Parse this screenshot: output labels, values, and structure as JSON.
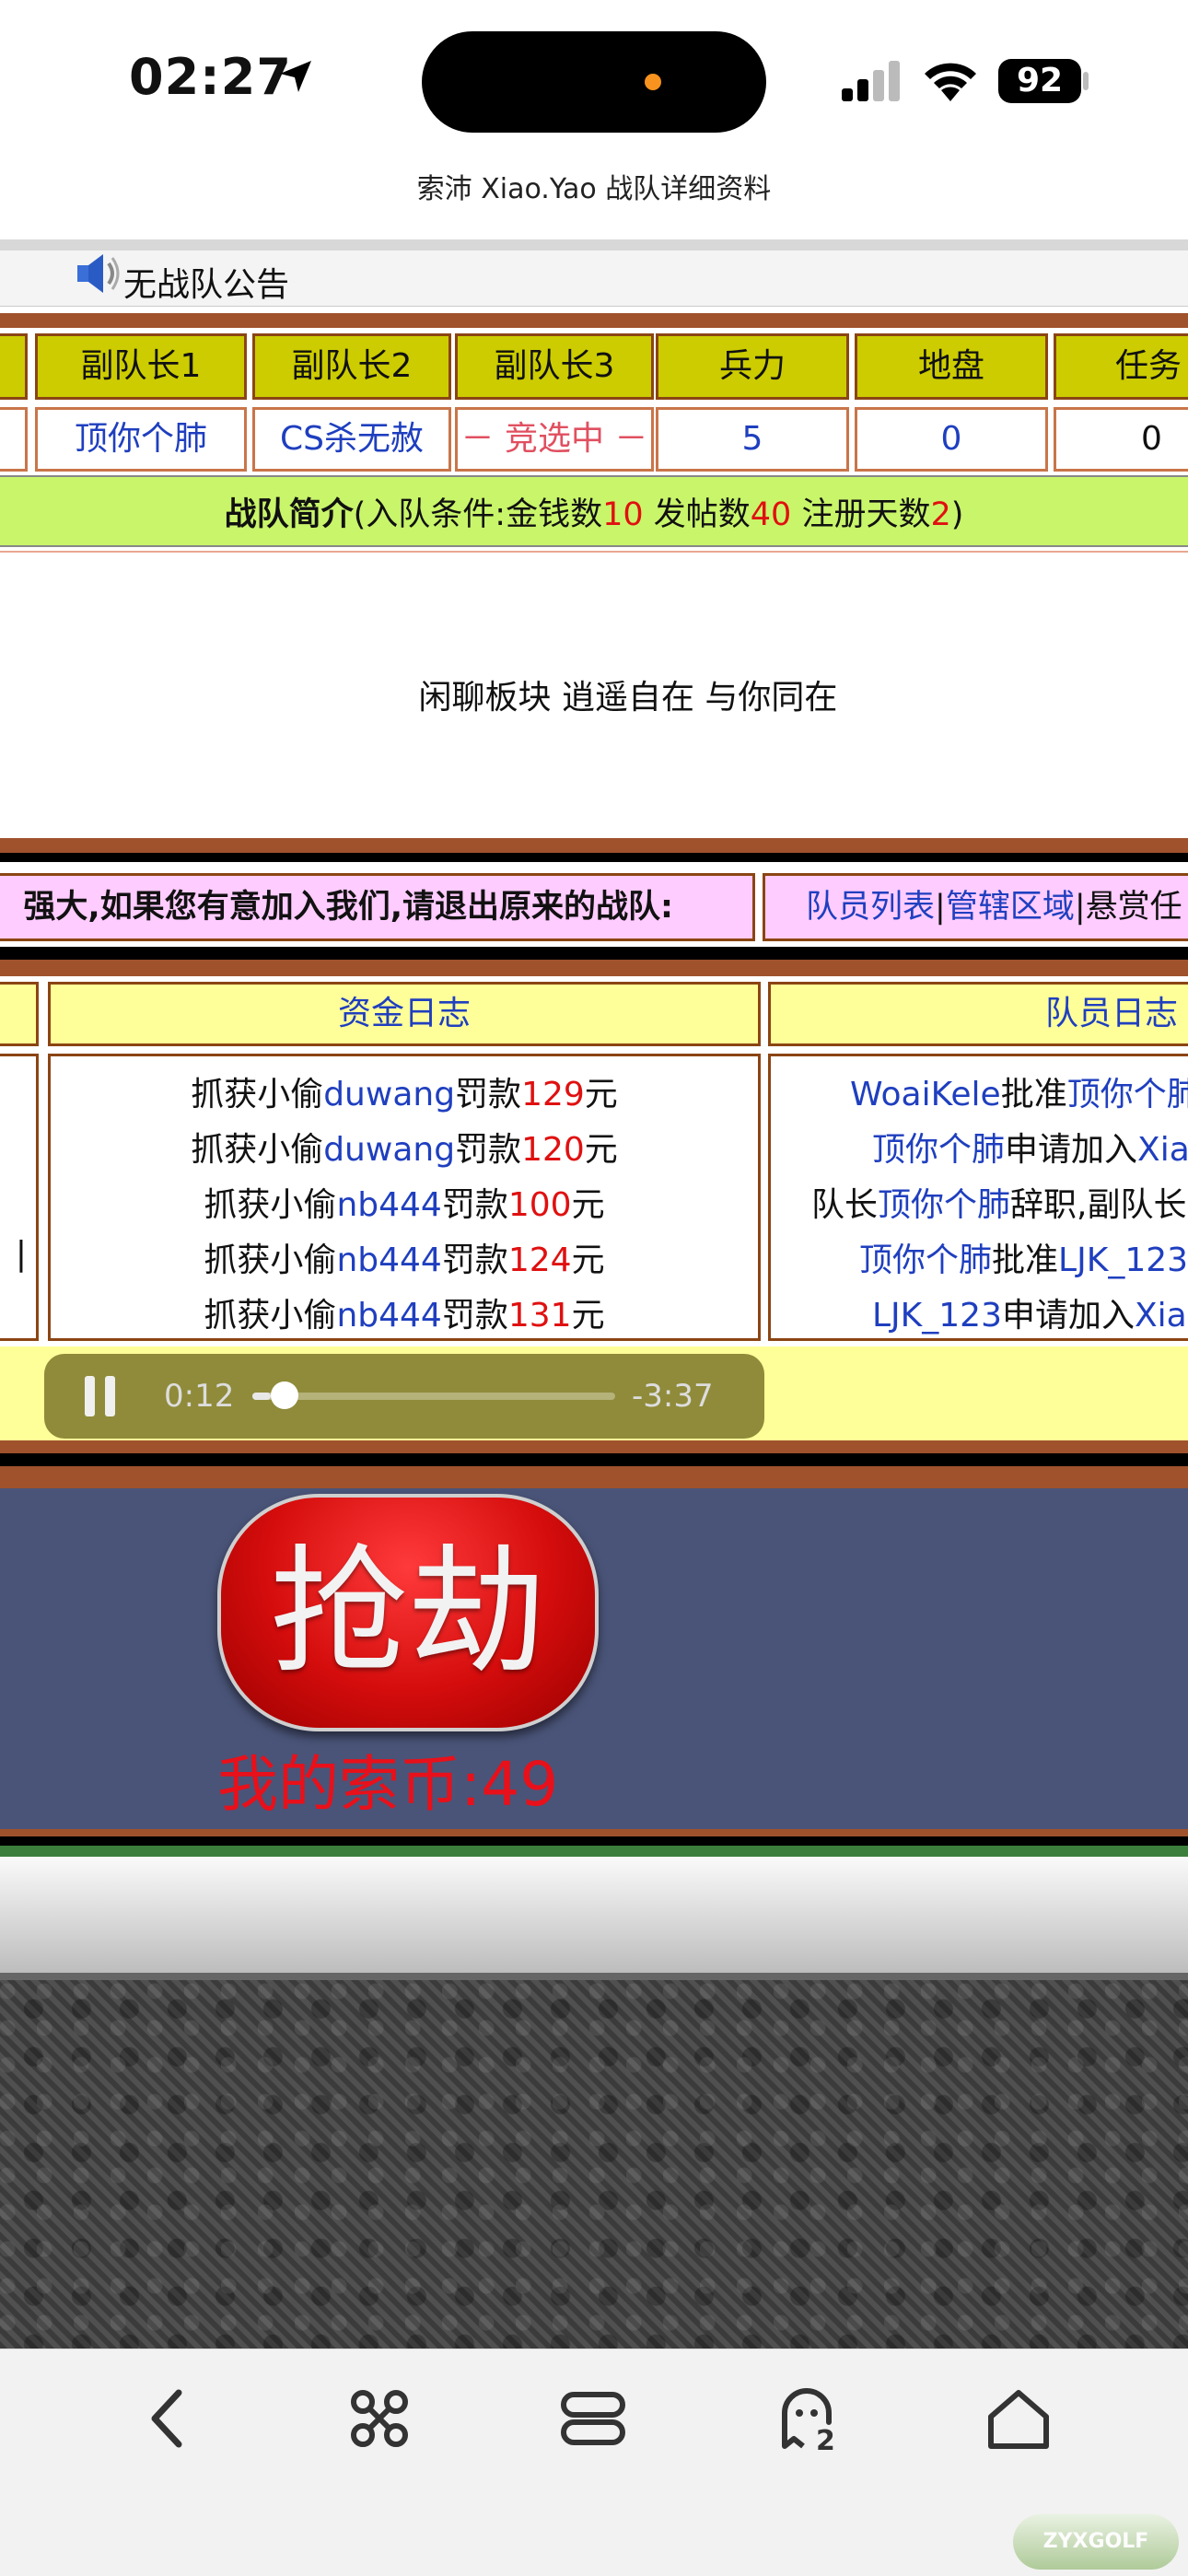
{
  "status_bar": {
    "time": "02:27",
    "battery": "92"
  },
  "page_title": "索沛 Xiao.Yao 战队详细资料",
  "announcement": "无战队公告",
  "team_table": {
    "headers": [
      "副队长1",
      "副队长2",
      "副队长3",
      "兵力",
      "地盘",
      "任务"
    ],
    "row": [
      "顶你个肺",
      "CS杀无赦",
      "－ 竞选中 －",
      "5",
      "0",
      "0"
    ]
  },
  "intro": {
    "label": "战队简介",
    "cond_prefix": "(入队条件:金钱数",
    "money": "10",
    "posts_label": " 发帖数",
    "posts": "40",
    "days_label": " 注册天数",
    "days": "2",
    "cond_suffix": ")",
    "content": "闲聊板块 逍遥自在 与你同在"
  },
  "recruit_bar": {
    "text": "强大,如果您有意加入我们,请退出原来的战队:",
    "links": [
      "队员列表",
      "管辖区域",
      "悬赏任"
    ],
    "separator": "|"
  },
  "fund_log": {
    "title": "资金日志",
    "entries": [
      {
        "prefix": "抓获小偷",
        "user": "duwang",
        "mid": "罚款",
        "amount": "129",
        "unit": "元"
      },
      {
        "prefix": "抓获小偷",
        "user": "duwang",
        "mid": "罚款",
        "amount": "120",
        "unit": "元"
      },
      {
        "prefix": "抓获小偷",
        "user": "nb444",
        "mid": "罚款",
        "amount": "100",
        "unit": "元"
      },
      {
        "prefix": "抓获小偷",
        "user": "nb444",
        "mid": "罚款",
        "amount": "124",
        "unit": "元"
      },
      {
        "prefix": "抓获小偷",
        "user": "nb444",
        "mid": "罚款",
        "amount": "131",
        "unit": "元"
      }
    ]
  },
  "member_log": {
    "title": "队员日志",
    "entries": [
      {
        "a": "",
        "u1": "WoaiKele",
        "b": "批准",
        "u2": "顶你个肺"
      },
      {
        "a": "",
        "u1": "顶你个肺",
        "b": "申请加入",
        "u2": "Xia"
      },
      {
        "a": "队长",
        "u1": "顶你个肺",
        "b": "辞职,副队长",
        "u2": ""
      },
      {
        "a": "",
        "u1": "顶你个肺",
        "b": "批准",
        "u2": "LJK_123"
      },
      {
        "a": "",
        "u1": "LJK_123",
        "b": "申请加入",
        "u2": "Xia"
      }
    ]
  },
  "audio": {
    "elapsed": "0:12",
    "remaining": "-3:37",
    "progress": 0.052
  },
  "rob": {
    "button_label": "抢劫",
    "coins_label": "我的索币:49"
  },
  "watermark": "ZYXGOLF"
}
